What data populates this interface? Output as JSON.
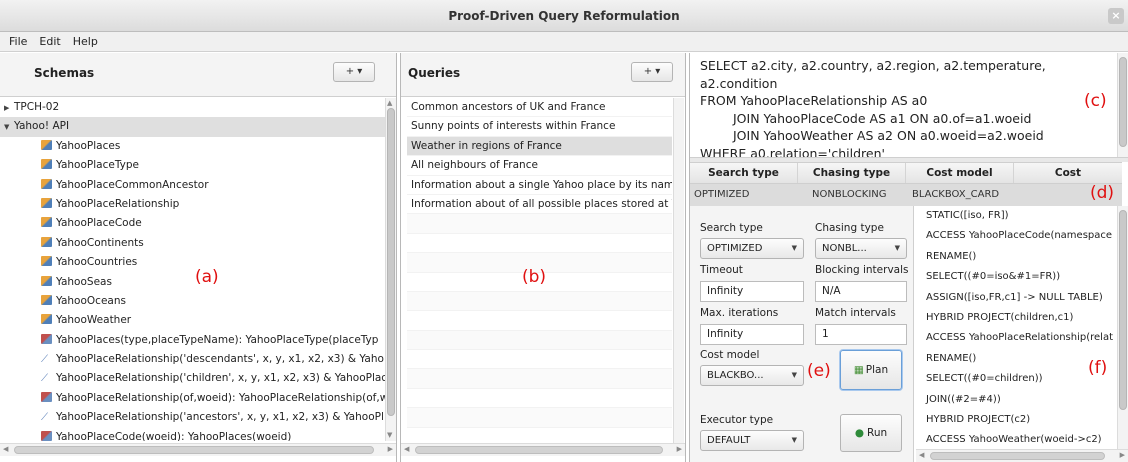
{
  "window": {
    "title": "Proof-Driven Query Reformulation",
    "close_glyph": "×"
  },
  "menu": [
    "File",
    "Edit",
    "Help"
  ],
  "schemas": {
    "title": "Schemas",
    "add_label": "+ ▾",
    "items": [
      {
        "label": "TPCH-02",
        "kind": "group",
        "expanded": false
      },
      {
        "label": "Yahoo! API",
        "kind": "group",
        "expanded": true
      },
      {
        "label": "YahooPlaces",
        "kind": "relation"
      },
      {
        "label": "YahooPlaceType",
        "kind": "relation"
      },
      {
        "label": "YahooPlaceCommonAncestor",
        "kind": "relation"
      },
      {
        "label": "YahooPlaceRelationship",
        "kind": "relation"
      },
      {
        "label": "YahooPlaceCode",
        "kind": "relation"
      },
      {
        "label": "YahooContinents",
        "kind": "relation"
      },
      {
        "label": "YahooCountries",
        "kind": "relation"
      },
      {
        "label": "YahooSeas",
        "kind": "relation"
      },
      {
        "label": "YahooOceans",
        "kind": "relation"
      },
      {
        "label": "YahooWeather",
        "kind": "relation"
      },
      {
        "label": "YahooPlaces(type,placeTypeName): YahooPlaceType(placeTyp",
        "kind": "dependency"
      },
      {
        "label": "YahooPlaceRelationship('descendants', x, y, x1, x2, x3) & Yaho",
        "kind": "link"
      },
      {
        "label": "YahooPlaceRelationship('children', x, y, x1, x2, x3) & YahooPlac",
        "kind": "link"
      },
      {
        "label": "YahooPlaceRelationship(of,woeid): YahooPlaceRelationship(of,w",
        "kind": "dependency"
      },
      {
        "label": "YahooPlaceRelationship('ancestors', x, y, x1, x2, x3) & YahooPl",
        "kind": "link"
      },
      {
        "label": "YahooPlaceCode(woeid): YahooPlaces(woeid)",
        "kind": "dependency"
      }
    ]
  },
  "queries": {
    "title": "Queries",
    "add_label": "+ ▾",
    "items": [
      "Common ancestors of UK and France",
      "Sunny points of interests within France",
      "Weather in regions of France",
      "All neighbours of France",
      "Information about a single Yahoo place by its name",
      "Information about of all possible places stored at Yah"
    ],
    "selected_index": 2
  },
  "sql": {
    "lines": [
      "SELECT a2.city, a2.country, a2.region, a2.temperature,",
      "a2.condition",
      "FROM YahooPlaceRelationship AS a0",
      "JOIN YahooPlaceCode AS a1 ON a0.of=a1.woeid",
      "JOIN YahooWeather AS a2 ON a0.woeid=a2.woeid",
      "WHERE a0.relation='children'"
    ]
  },
  "plans_table": {
    "headers": [
      "Search type",
      "Chasing type",
      "Cost model",
      "Cost"
    ],
    "rows": [
      [
        "OPTIMIZED",
        "NONBLOCKING",
        "BLACKBOX_CARD",
        ""
      ]
    ]
  },
  "planner": {
    "search_type_label": "Search type",
    "search_type_value": "OPTIMIZED",
    "chasing_type_label": "Chasing type",
    "chasing_type_value": "NONBL...",
    "timeout_label": "Timeout",
    "timeout_value": "Infinity",
    "blocking_label": "Blocking intervals",
    "blocking_value": "N/A",
    "max_iter_label": "Max. iterations",
    "max_iter_value": "Infinity",
    "match_label": "Match intervals",
    "match_value": "1",
    "cost_model_label": "Cost model",
    "cost_model_value": "BLACKBO...",
    "plan_button": "Plan",
    "executor_label": "Executor type",
    "executor_value": "DEFAULT",
    "run_button": "Run"
  },
  "plan_ops": [
    "STATIC([iso, FR])",
    "ACCESS YahooPlaceCode(namespace",
    "RENAME()",
    "SELECT((#0=iso&#1=FR))",
    "ASSIGN([iso,FR,c1] -> NULL TABLE)",
    "HYBRID PROJECT(children,c1)",
    "ACCESS YahooPlaceRelationship(relat",
    "RENAME()",
    "SELECT((#0=children))",
    "JOIN((#2=#4))",
    "HYBRID PROJECT(c2)",
    "ACCESS YahooWeather(woeid->c2)"
  ],
  "annotations": {
    "a": "(a)",
    "b": "(b)",
    "c": "(c)",
    "d": "(d)",
    "e": "(e)",
    "f": "(f)"
  },
  "colors": {
    "annotation": "#e01010",
    "selection": "#dedede"
  }
}
